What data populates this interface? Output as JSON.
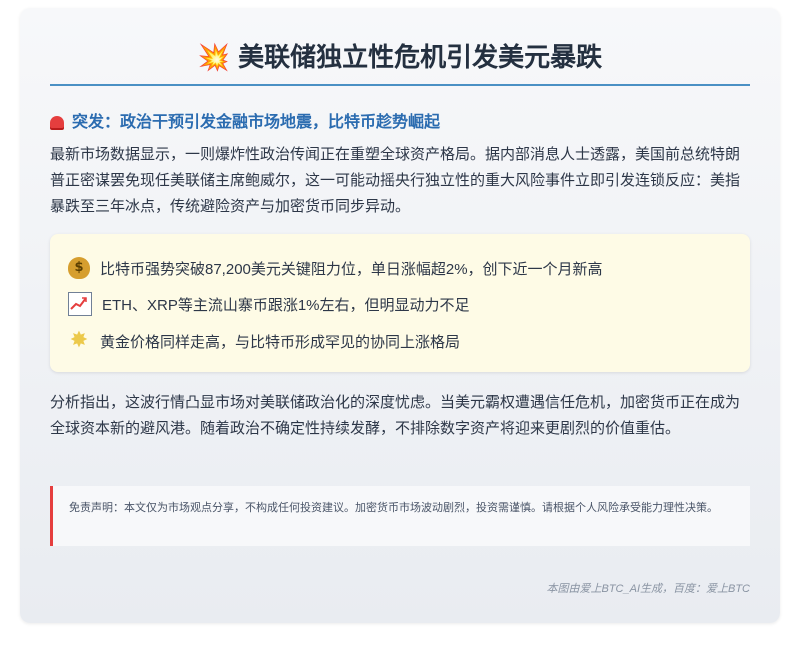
{
  "title": {
    "emoji": "💥",
    "text": "美联储独立性危机引发美元暴跌"
  },
  "subheading": "突发：政治干预引发金融市场地震，比特币趁势崛起",
  "paragraph1": "最新市场数据显示，一则爆炸性政治传闻正在重塑全球资产格局。据内部消息人士透露，美国前总统特朗普正密谋罢免现任美联储主席鲍威尔，这一可能动摇央行独立性的重大风险事件立即引发连锁反应：美指暴跌至三年冰点，传统避险资产与加密货币同步异动。",
  "highlights": [
    {
      "icon": "money-bag-icon",
      "glyph": "$",
      "text": "比特币强势突破87,200美元关键阻力位，单日涨幅超2%，创下近一个月新高"
    },
    {
      "icon": "chart-up-icon",
      "glyph": "",
      "text": "ETH、XRP等主流山寨币跟涨1%左右，但明显动力不足"
    },
    {
      "icon": "sparkle-icon",
      "glyph": "✸",
      "text": "黄金价格同样走高，与比特币形成罕见的协同上涨格局"
    }
  ],
  "paragraph2": "分析指出，这波行情凸显市场对美联储政治化的深度忧虑。当美元霸权遭遇信任危机，加密货币正在成为全球资本新的避风港。随着政治不确定性持续发酵，不排除数字资产将迎来更剧烈的价值重估。",
  "disclaimer": "免责声明：本文仅为市场观点分享，不构成任何投资建议。加密货币市场波动剧烈，投资需谨慎。请根据个人风险承受能力理性决策。",
  "footer": "本图由爱上BTC_AI生成，百度：爱上BTC",
  "colors": {
    "title": "#243040",
    "accent_blue": "#2b6cb0",
    "rule": "#4a90c4",
    "alert_red": "#e53e3e",
    "highlight_bg": "#fefbe6"
  }
}
